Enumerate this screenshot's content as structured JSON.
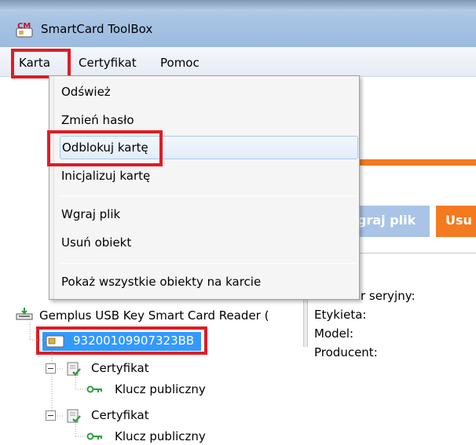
{
  "window": {
    "title": "SmartCard ToolBox"
  },
  "menubar": {
    "items": [
      "Karta",
      "Certyfikat",
      "Pomoc"
    ]
  },
  "dropdown": {
    "items": [
      "Odśwież",
      "Zmień hasło",
      "Odblokuj kartę",
      "Inicjalizuj kartę",
      "Wgraj plik",
      "Usuń obiekt",
      "Pokaż wszystkie obiekty na karcie"
    ],
    "highlighted": "Odblokuj kartę"
  },
  "toolbar": {
    "upload_label": "graj plik",
    "delete_label": "Usu"
  },
  "info": {
    "serial_label": "r seryjny:",
    "label_label": "Etykieta:",
    "model_label": "Model:",
    "producer_label": "Producent:"
  },
  "tree": {
    "reader": "Gemplus USB Key Smart Card Reader (",
    "card": "93200109907323BB",
    "cert1": "Certyfikat",
    "key1": "Klucz publiczny",
    "cert2": "Certyfikat",
    "key2": "Klucz publiczny"
  },
  "colors": {
    "highlight_box": "#e01b24",
    "accent_orange": "#f47a20",
    "selection_blue": "#3399ff"
  }
}
